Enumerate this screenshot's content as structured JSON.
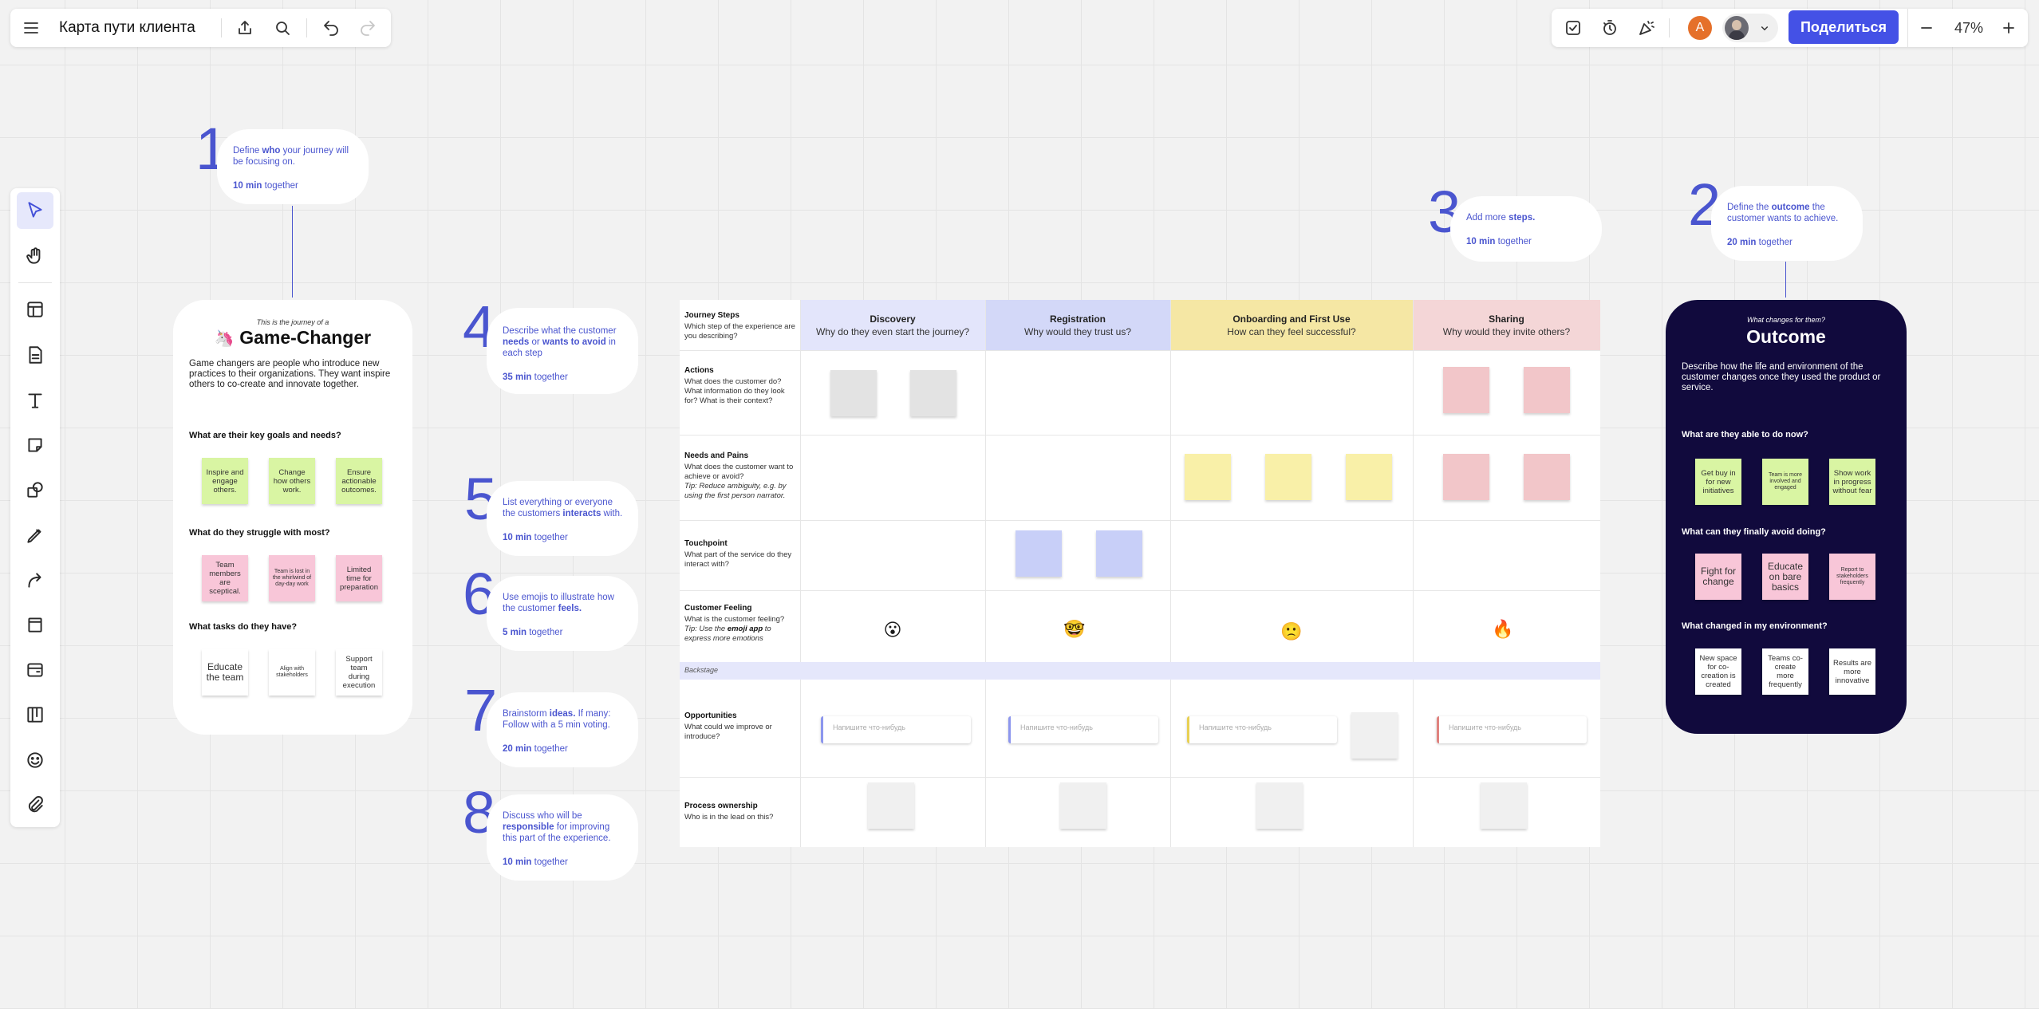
{
  "topbar": {
    "title": "Карта пути клиента",
    "share_label": "Поделиться",
    "avatar_initial": "A",
    "zoom": "47%"
  },
  "steps": [
    {
      "num": "1",
      "pre": "Define ",
      "bold": "who",
      "post": " your journey will be focusing on.",
      "time_bold": "10 min",
      "time_rest": " together"
    },
    {
      "num": "2",
      "pre": "Define the ",
      "bold": "outcome",
      "post": " the customer wants to achieve.",
      "time_bold": "20 min",
      "time_rest": " together"
    },
    {
      "num": "3",
      "pre": "Add more ",
      "bold": "steps.",
      "post": "",
      "time_bold": "10 min",
      "time_rest": " together"
    },
    {
      "num": "4",
      "pre": "Describe what the customer ",
      "bold": "needs",
      "mid": " or ",
      "bold2": "wants to avoid",
      "post": " in each step",
      "time_bold": "35 min",
      "time_rest": " together"
    },
    {
      "num": "5",
      "pre": "List everything or everyone the customers ",
      "bold": "interacts",
      "post": " with.",
      "time_bold": "10 min",
      "time_rest": " together"
    },
    {
      "num": "6",
      "pre": "Use emojis to illustrate how the customer ",
      "bold": "feels.",
      "post": "",
      "time_bold": "5 min",
      "time_rest": " together"
    },
    {
      "num": "7",
      "pre": "Brainstorm ",
      "bold": "ideas.",
      "post": " If many: Follow with a 5 min voting.",
      "time_bold": "20 min",
      "time_rest": " together"
    },
    {
      "num": "8",
      "pre": "Discuss who will be ",
      "bold": "responsible",
      "post": " for improving this part of the experience.",
      "time_bold": "10 min",
      "time_rest": " together"
    }
  ],
  "persona": {
    "pre": "This is the journey of a",
    "title": "Game-Changer",
    "description": "Game changers are people who introduce new practices to their organizations. They want inspire others to co-create and innovate together.",
    "q1": "What are their key goals and needs?",
    "goals": [
      "Inspire and engage others.",
      "Change how others work.",
      "Ensure actionable outcomes."
    ],
    "q2": "What do they struggle with most?",
    "struggles": [
      "Team members are sceptical.",
      "Team is lost in the whirlwind of day-day work",
      "Limited time for preparation"
    ],
    "q3": "What tasks do they have?",
    "tasks": [
      "Educate the team",
      "Align with stakeholders",
      "Support team during execution"
    ]
  },
  "outcome": {
    "pre": "What changes for them?",
    "title": "Outcome",
    "description": "Describe how the life and environment of the customer changes once they used the product or service.",
    "q1": "What are they able to do now?",
    "able": [
      "Get buy in for new initiatives",
      "Team is more involved and engaged",
      "Show work in progress without fear"
    ],
    "q2": "What can they finally avoid doing?",
    "avoid": [
      "Fight for change",
      "Educate on bare basics",
      "Report to stakeholders frequently"
    ],
    "q3": "What changed in my environment?",
    "changed": [
      "New space for co-creation is created",
      "Teams co-create more frequently",
      "Results are more innovative"
    ]
  },
  "journey": {
    "columns": [
      {
        "title": "Discovery",
        "subtitle": "Why do they even start the journey?",
        "color": "#e3e5fb"
      },
      {
        "title": "Registration",
        "subtitle": "Why would they trust us?",
        "color": "#d3d8f8"
      },
      {
        "title": "Onboarding and First Use",
        "subtitle": "How can they feel successful?",
        "color": "#f5e7a4"
      },
      {
        "title": "Sharing",
        "subtitle": "Why would they invite others?",
        "color": "#f4d6d7"
      }
    ],
    "rows": {
      "steps": {
        "title": "Journey Steps",
        "desc": "Which step of the experience are you describing?"
      },
      "actions": {
        "title": "Actions",
        "desc": "What does the customer do? What information do they look for? What is their context?"
      },
      "needs": {
        "title": "Needs and Pains",
        "desc": "What does the customer want to achieve or avoid?",
        "tip": "Tip: Reduce ambiguity, e.g. by using the first person narrator."
      },
      "touchpoint": {
        "title": "Touchpoint",
        "desc": "What part of the service do they interact with?"
      },
      "feeling": {
        "title": "Customer Feeling",
        "desc": "What is the customer feeling?",
        "tip_pre": "Tip: Use the ",
        "tip_bold": "emoji app",
        "tip_post": " to express more emotions"
      },
      "opportunities": {
        "title": "Opportunities",
        "desc": "What could we improve or introduce?"
      },
      "ownership": {
        "title": "Process ownership",
        "desc": "Who is in the lead on this?"
      }
    },
    "backstage": "Backstage",
    "emojis": [
      "😮",
      "🤓",
      "🙁",
      "🔥"
    ],
    "placeholder": "Напишите что-нибудь"
  }
}
